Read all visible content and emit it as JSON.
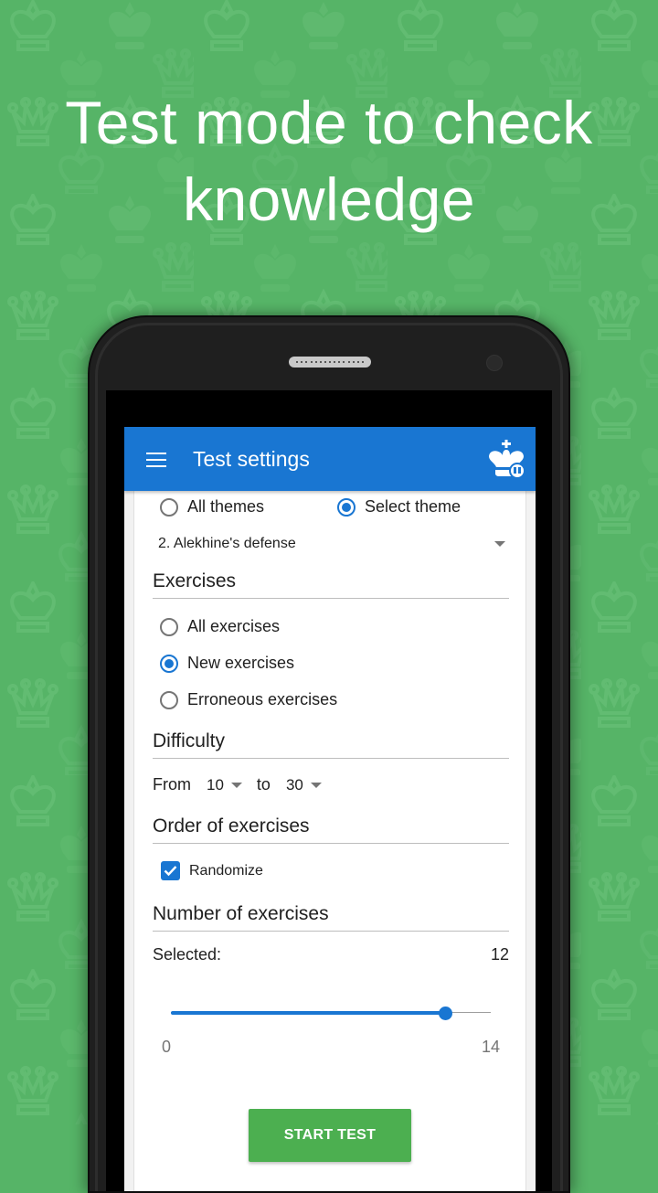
{
  "headline": {
    "line1": "Test mode to check",
    "line2": "knowledge"
  },
  "colors": {
    "background": "#56b467",
    "appbar": "#1976d2",
    "accent": "#1976d2",
    "start_button": "#4caf50"
  },
  "appbar": {
    "title": "Test settings",
    "menu_icon": "hamburger-menu-icon",
    "logo_icon": "chess-king-icon"
  },
  "themes": {
    "options": [
      {
        "label": "All themes",
        "selected": false
      },
      {
        "label": "Select theme",
        "selected": true
      }
    ],
    "selected_theme": "2. Alekhine's defense"
  },
  "exercises": {
    "header": "Exercises",
    "options": [
      {
        "label": "All exercises",
        "selected": false
      },
      {
        "label": "New exercises",
        "selected": true
      },
      {
        "label": "Erroneous exercises",
        "selected": false
      }
    ]
  },
  "difficulty": {
    "header": "Difficulty",
    "from_label": "From",
    "from_value": "10",
    "to_label": "to",
    "to_value": "30"
  },
  "order": {
    "header": "Order of exercises",
    "randomize_label": "Randomize",
    "randomize_checked": true
  },
  "number": {
    "header": "Number of exercises",
    "selected_label": "Selected:",
    "selected_value": "12",
    "min": "0",
    "max": "14",
    "value": 12
  },
  "start_button": "START TEST"
}
